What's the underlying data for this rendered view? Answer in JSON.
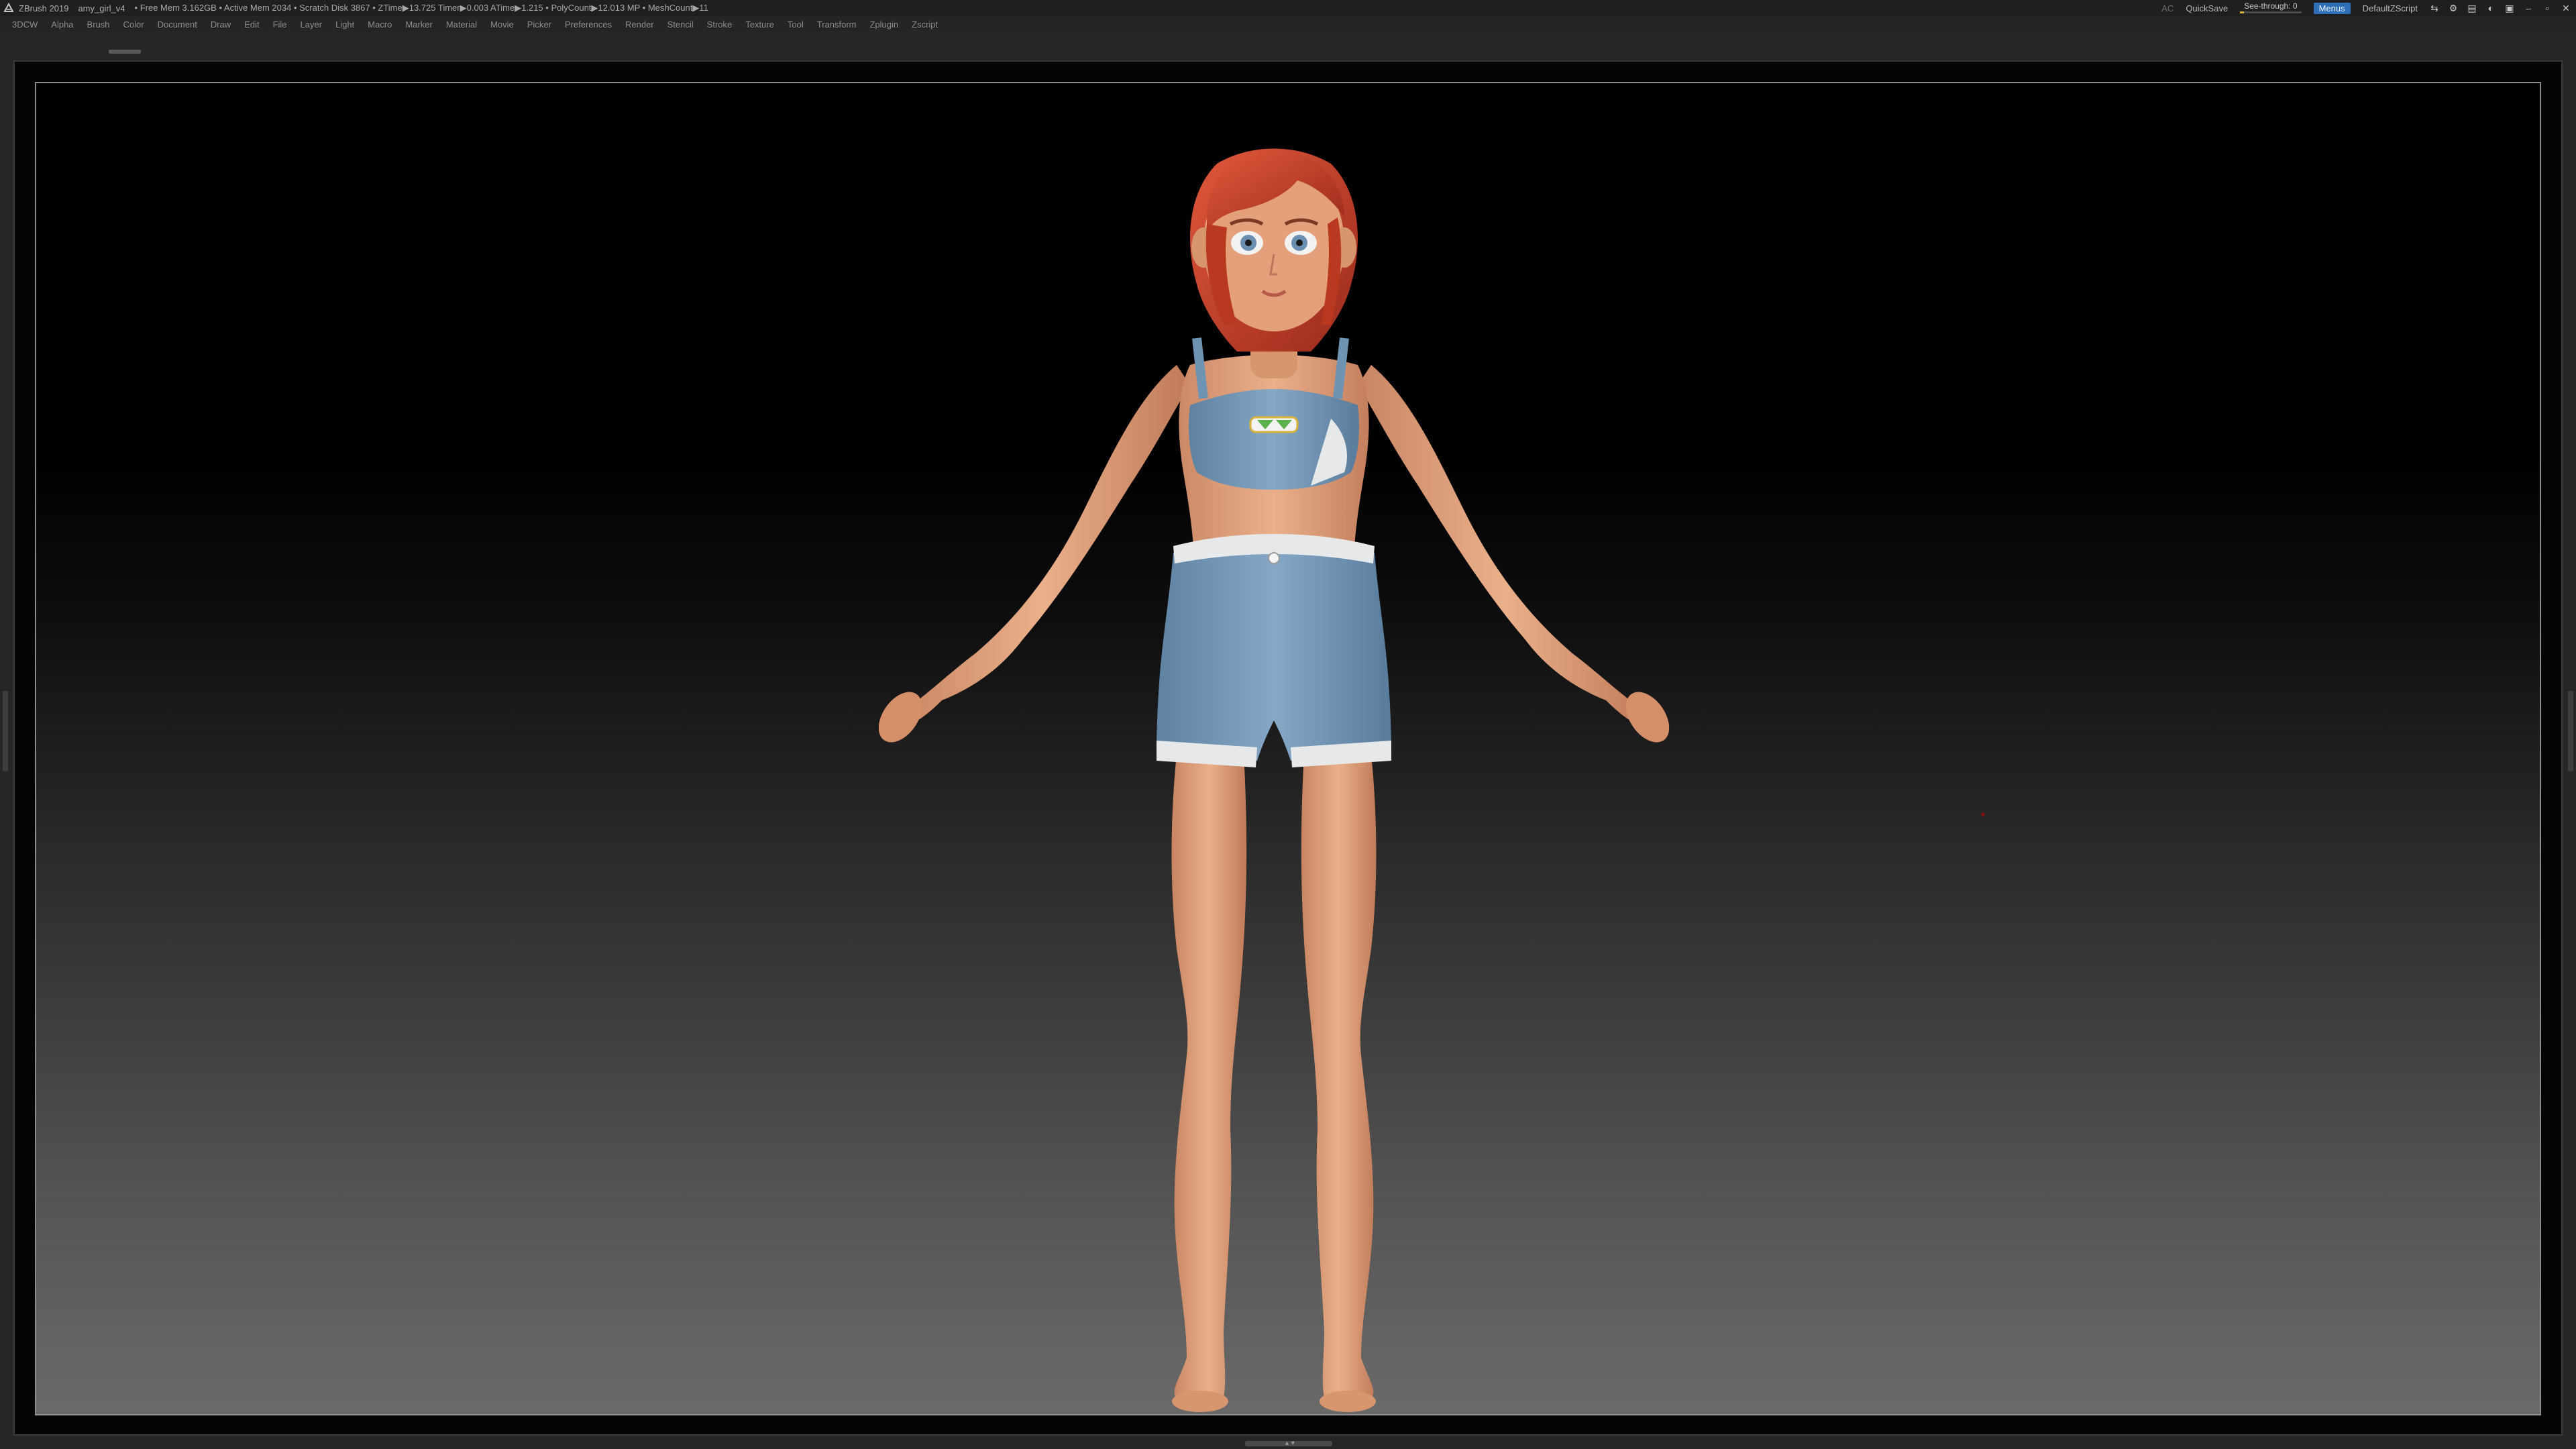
{
  "titlebar": {
    "app_name": "ZBrush 2019",
    "file_name": "amy_girl_v4",
    "stats": "• Free Mem 3.162GB • Active Mem 2034 • Scratch Disk 3867 •  ZTime▶13.725 Timer▶0.003 ATime▶1.215 • PolyCount▶12.013 MP • MeshCount▶11",
    "ac_label": "AC",
    "quicksave_label": "QuickSave",
    "seethrough_label": "See-through",
    "seethrough_value": "0",
    "seethrough_fraction": 0.0,
    "menus_label": "Menus",
    "script_label": "DefaultZScript"
  },
  "menubar": {
    "items": [
      "3DCW",
      "Alpha",
      "Brush",
      "Color",
      "Document",
      "Draw",
      "Edit",
      "File",
      "Layer",
      "Light",
      "Macro",
      "Marker",
      "Material",
      "Movie",
      "Picker",
      "Preferences",
      "Render",
      "Stencil",
      "Stroke",
      "Texture",
      "Tool",
      "Transform",
      "Zplugin",
      "Zscript"
    ]
  },
  "colors": {
    "accent_blue": "#2f6fb8",
    "skin": "#e3a07a",
    "hair": "#c9432c",
    "outfit_blue": "#6f93b3",
    "outfit_trim": "#e6e8ea"
  },
  "icons": [
    "zbrush-logo-icon",
    "layout-icon",
    "interface-icon",
    "minimize-icon",
    "maximize-icon",
    "close-icon"
  ]
}
